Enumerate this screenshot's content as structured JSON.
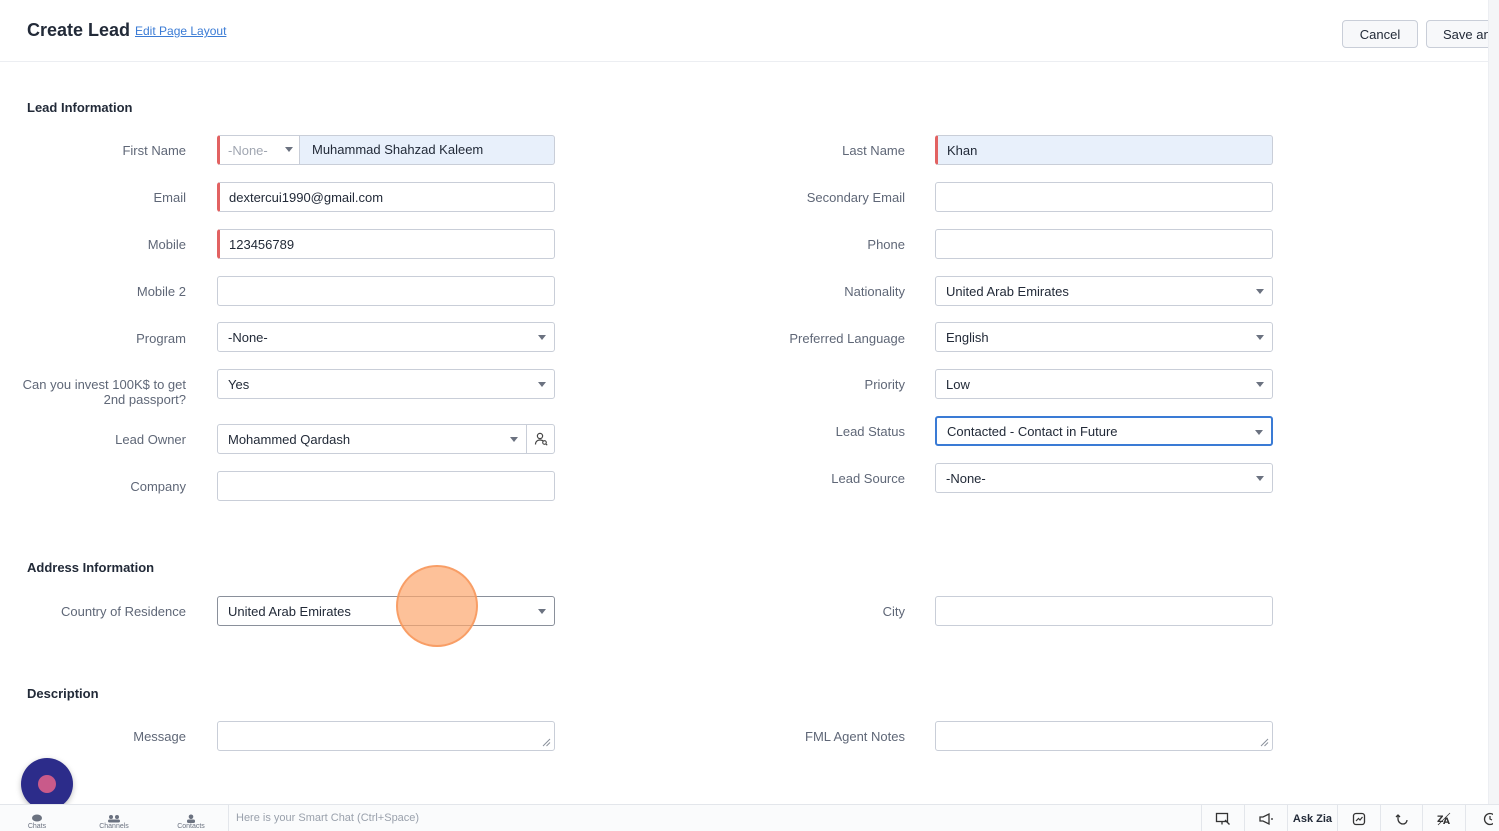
{
  "header": {
    "title": "Create Lead",
    "edit_layout": "Edit Page Layout",
    "cancel": "Cancel",
    "save": "Save and"
  },
  "sections": {
    "lead_info": "Lead Information",
    "address_info": "Address Information",
    "description": "Description"
  },
  "fields": {
    "first_name": {
      "label": "First Name",
      "salutation": "-None-",
      "value": "Muhammad Shahzad Kaleem"
    },
    "last_name": {
      "label": "Last Name",
      "value": "Khan"
    },
    "email": {
      "label": "Email",
      "value": "dextercui1990@gmail.com"
    },
    "secondary_email": {
      "label": "Secondary Email",
      "value": ""
    },
    "mobile": {
      "label": "Mobile",
      "value": "123456789"
    },
    "phone": {
      "label": "Phone",
      "value": ""
    },
    "mobile2": {
      "label": "Mobile 2",
      "value": ""
    },
    "nationality": {
      "label": "Nationality",
      "value": "United Arab Emirates"
    },
    "program": {
      "label": "Program",
      "value": "-None-"
    },
    "preferred_language": {
      "label": "Preferred Language",
      "value": "English"
    },
    "invest": {
      "label_line1": "Can you invest 100K$ to get",
      "label_line2": "2nd passport?",
      "value": "Yes"
    },
    "priority": {
      "label": "Priority",
      "value": "Low"
    },
    "lead_owner": {
      "label": "Lead Owner",
      "value": "Mohammed Qardash"
    },
    "lead_status": {
      "label": "Lead Status",
      "value": "Contacted - Contact in Future"
    },
    "company": {
      "label": "Company",
      "value": ""
    },
    "lead_source": {
      "label": "Lead Source",
      "value": "-None-"
    },
    "country_residence": {
      "label": "Country of Residence",
      "value": "United Arab Emirates"
    },
    "city": {
      "label": "City",
      "value": ""
    },
    "message": {
      "label": "Message",
      "value": ""
    },
    "fml_notes": {
      "label": "FML Agent Notes",
      "value": ""
    }
  },
  "bottombar": {
    "chats": "Chats",
    "channels": "Channels",
    "contacts": "Contacts",
    "smart_chat": "Here is your Smart Chat (Ctrl+Space)",
    "ask_zia": "Ask Zia"
  }
}
